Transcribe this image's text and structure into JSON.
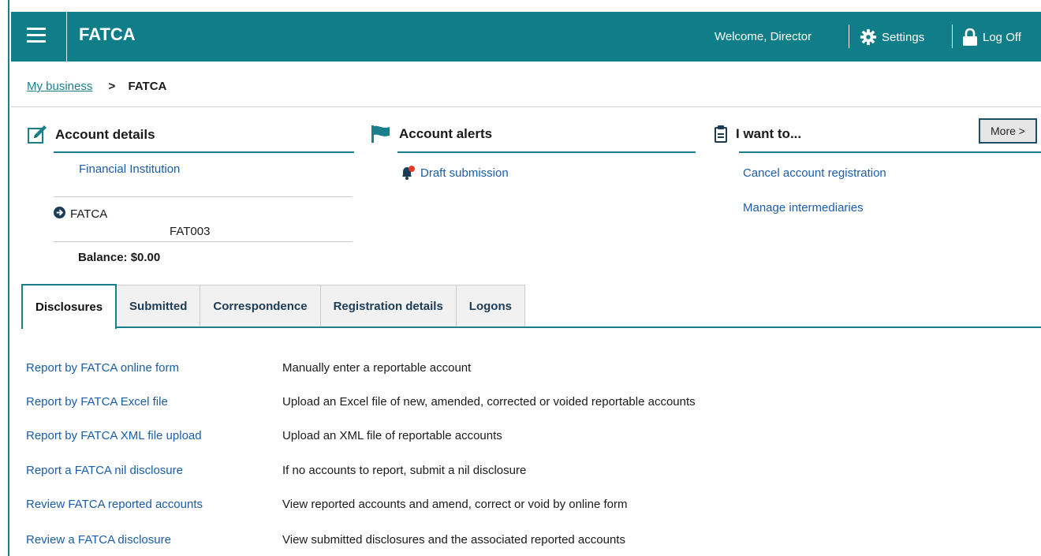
{
  "header": {
    "app_title": "FATCA",
    "welcome": "Welcome, Director",
    "settings_label": "Settings",
    "logoff_label": "Log Off",
    "bg_color": "#107e88"
  },
  "breadcrumb": {
    "parent": "My business",
    "separator": ">",
    "current": "FATCA"
  },
  "account_details": {
    "title": "Account details",
    "institution_link": "Financial Institution",
    "account_name": "FATCA",
    "account_id": "FAT003",
    "balance": "Balance: $0.00"
  },
  "account_alerts": {
    "title": "Account alerts",
    "items": [
      {
        "label": "Draft submission",
        "icon": "bell-alert-icon"
      }
    ]
  },
  "i_want_to": {
    "title": "I want to...",
    "more_label": "More >",
    "links": [
      "Cancel account registration",
      "Manage intermediaries"
    ]
  },
  "tabs": [
    {
      "label": "Disclosures",
      "active": true
    },
    {
      "label": "Submitted",
      "active": false
    },
    {
      "label": "Correspondence",
      "active": false
    },
    {
      "label": "Registration details",
      "active": false
    },
    {
      "label": "Logons",
      "active": false
    }
  ],
  "disclosures": [
    {
      "link": "Report by FATCA online form",
      "desc": "Manually enter a reportable account"
    },
    {
      "link": "Report by FATCA Excel file",
      "desc": "Upload an Excel file of new, amended, corrected or voided reportable accounts"
    },
    {
      "link": "Report by FATCA XML file upload",
      "desc": "Upload an XML file of reportable accounts"
    },
    {
      "link": "Report a FATCA nil disclosure",
      "desc": "If no accounts to report, submit a nil disclosure"
    },
    {
      "link": "Review FATCA reported accounts",
      "desc": "View reported accounts and amend, correct or void by online form"
    },
    {
      "link": "Review a FATCA disclosure",
      "desc": "View submitted disclosures and the associated reported accounts"
    }
  ],
  "colors": {
    "accent": "#1a7f8a",
    "link": "#1a5da8"
  }
}
